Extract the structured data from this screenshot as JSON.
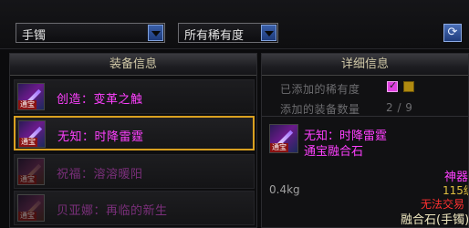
{
  "toolbar": {
    "category_value": "手镯",
    "rarity_value": "所有稀有度",
    "refresh_icon": "refresh-icon"
  },
  "left_panel": {
    "title": "装备信息",
    "items": [
      {
        "name": "创造：变革之触",
        "color": "#ff40ff",
        "selected": false,
        "dim": false
      },
      {
        "name": "无知：时降雷霆",
        "color": "#ff40ff",
        "selected": true,
        "dim": false
      },
      {
        "name": "祝福：溶溶暖阳",
        "color": "#7a2f7a",
        "selected": false,
        "dim": true
      },
      {
        "name": "贝亚娜：再临的新生",
        "color": "#7a2f7a",
        "selected": false,
        "dim": true
      }
    ],
    "icon_tag": "通宝"
  },
  "right_panel": {
    "title": "详细信息",
    "added_rarity_label": "已添加的稀有度",
    "added_count_label": "添加的装备数量",
    "added_count_value": "2 / 9",
    "rarity_colors": [
      "#e040e0",
      "#b08a10"
    ],
    "detail_name": "无知：时降雷霆",
    "detail_type": "通宝融合石",
    "icon_tag": "通宝",
    "weight": "0.4kg",
    "grade_text": "神器",
    "level_text": "115级",
    "trade_text": "无法交易",
    "fusion_text": "融合石(手镯)"
  }
}
